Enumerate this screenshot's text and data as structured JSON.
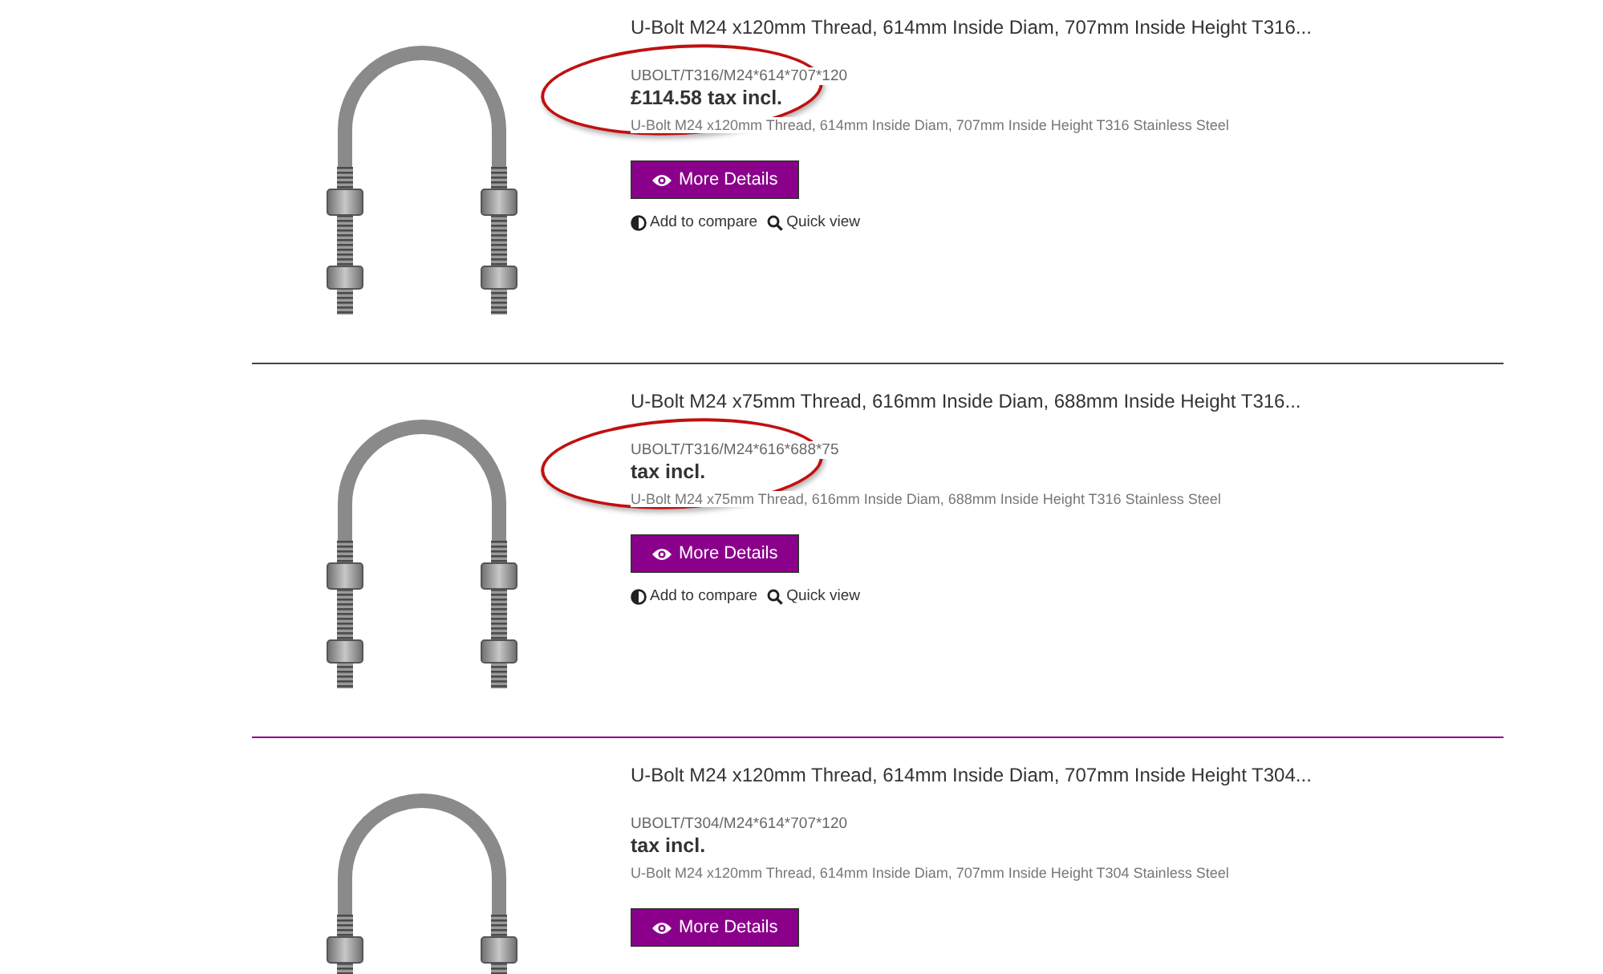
{
  "products": [
    {
      "title": "U-Bolt M24 x120mm Thread, 614mm Inside Diam, 707mm Inside Height T316...",
      "sku": "UBOLT/T316/M24*614*707*120",
      "price": "£114.58 tax incl.",
      "description": "U-Bolt M24 x120mm Thread, 614mm Inside Diam, 707mm Inside Height T316 Stainless Steel",
      "button": "More Details",
      "compare": "Add to compare",
      "quick_view": "Quick view",
      "circled": true
    },
    {
      "title": "U-Bolt M24 x75mm Thread, 616mm Inside Diam, 688mm Inside Height T316...",
      "sku": "UBOLT/T316/M24*616*688*75",
      "price": "tax incl.",
      "description": "U-Bolt M24 x75mm Thread, 616mm Inside Diam, 688mm Inside Height T316 Stainless Steel",
      "button": "More Details",
      "compare": "Add to compare",
      "quick_view": "Quick view",
      "circled": true
    },
    {
      "title": "U-Bolt M24 x120mm Thread, 614mm Inside Diam, 707mm Inside Height T304...",
      "sku": "UBOLT/T304/M24*614*707*120",
      "price": "tax incl.",
      "description": "U-Bolt M24 x120mm Thread, 614mm Inside Diam, 707mm Inside Height T304 Stainless Steel",
      "button": "More Details",
      "circled": false
    }
  ]
}
